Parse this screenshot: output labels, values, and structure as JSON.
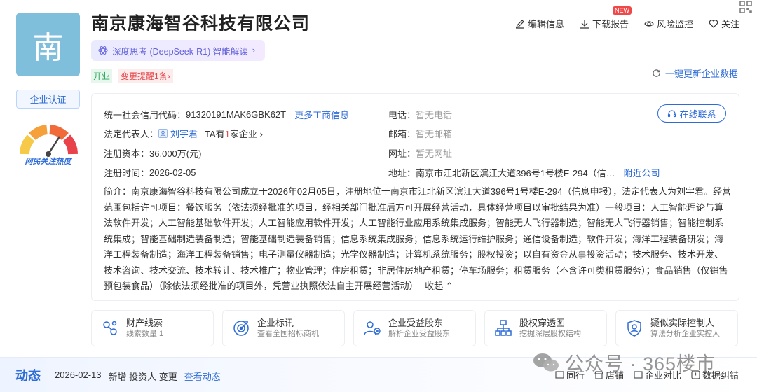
{
  "company": {
    "logo_char": "南",
    "name": "南京康海智谷科技有限公司",
    "ai_label": "深度思考 (DeepSeek-R1) 智能解读",
    "ai_chevron": "›",
    "status": "开业",
    "change_notice": "变更提醒1条",
    "change_chevron": "›"
  },
  "actions": {
    "edit": "编辑信息",
    "download": "下载报告",
    "new_badge": "NEW",
    "risk": "风险监控",
    "follow": "关注",
    "refresh": "一键更新企业数据"
  },
  "left": {
    "cert": "企业认证",
    "heat_label": "网民关注热度"
  },
  "info": {
    "credit_label": "统一社会信用代码：",
    "credit_value": "91320191MAK6GBK62T",
    "more_link": "更多工商信息",
    "legal_label": "法定代表人：",
    "legal_name": "刘宇君",
    "legal_extra_pre": "TA有",
    "legal_extra_count": "1",
    "legal_extra_post": "家企业",
    "legal_chevron": "›",
    "capital_label": "注册资本：",
    "capital_value": "36,000万(元)",
    "date_label": "注册时间：",
    "date_value": "2026-02-05",
    "phone_label": "电话：",
    "phone_value": "暂无电话",
    "email_label": "邮箱：",
    "email_value": "暂无邮箱",
    "site_label": "网址：",
    "site_value": "暂无网址",
    "addr_label": "地址：",
    "addr_value": "南京市江北新区滨江大道396号1号楼E-294（信…",
    "nearby": "附近公司",
    "contact_btn": "在线联系",
    "intro_label": "简介：",
    "intro_text": "南京康海智谷科技有限公司成立于2026年02月05日，注册地位于南京市江北新区滨江大道396号1号楼E-294（信息申报），法定代表人为刘宇君。经营范围包括许可项目：餐饮服务（依法须经批准的项目，经相关部门批准后方可开展经营活动，具体经营项目以审批结果为准）一般项目：人工智能理论与算法软件开发；人工智能基础软件开发；人工智能应用软件开发；人工智能行业应用系统集成服务；智能无人飞行器制造；智能无人飞行器销售；智能控制系统集成；智能基础制造装备制造；智能基础制造装备销售；信息系统集成服务；信息系统运行维护服务；通信设备制造；软件开发；海洋工程装备研发；海洋工程装备制造；海洋工程装备销售；电子测量仪器制造；光学仪器制造；计算机系统服务；股权投资；以自有资金从事投资活动；技术服务、技术开发、技术咨询、技术交流、技术转让、技术推广；物业管理；住房租赁；非居住房地产租赁；停车场服务；租赁服务（不含许可类租赁服务）；食品销售（仅销售预包装食品）（除依法须经批准的项目外，凭营业执照依法自主开展经营活动）",
    "collapse": "收起",
    "collapse_chevron": "⌃"
  },
  "features": [
    {
      "title": "财产线索",
      "sub": "线索数量 1",
      "icon": "property-clue-icon"
    },
    {
      "title": "企业标讯",
      "sub": "查看全国招标商机",
      "icon": "bid-target-icon"
    },
    {
      "title": "企业受益股东",
      "sub": "解析企业受益股东",
      "icon": "beneficiary-icon"
    },
    {
      "title": "股权穿透图",
      "sub": "挖掘深层股权结构",
      "icon": "equity-tree-icon"
    },
    {
      "title": "疑似实际控制人",
      "sub": "算法分析企业实控人",
      "icon": "controller-shield-icon"
    }
  ],
  "dynamic": {
    "title": "动态",
    "date": "2026-02-13",
    "text": "新增 投资人 变更",
    "link": "查看动态"
  },
  "bottom_tools": {
    "peer": "同行",
    "store": "店铺",
    "compare": "企业对比",
    "correct": "数据纠错"
  },
  "watermark": "公众号 · 365楼市",
  "colors": {
    "accent": "#2d6bd6",
    "logo_bg": "#7fbfdc",
    "open_green": "#26a65b",
    "alert_red": "#e5484d"
  }
}
